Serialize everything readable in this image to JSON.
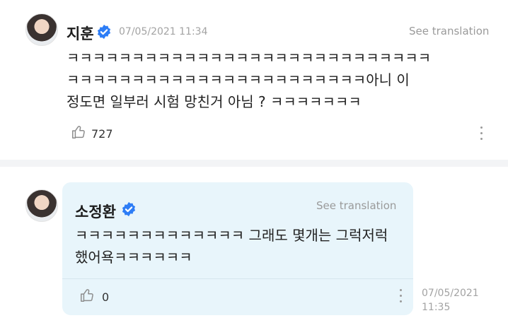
{
  "comment1": {
    "author": "지훈",
    "timestamp": "07/05/2021 11:34",
    "see_translation": "See translation",
    "text_lines": [
      "ㅋㅋㅋㅋㅋㅋㅋㅋㅋㅋㅋㅋㅋㅋㅋㅋㅋㅋㅋㅋㅋㅋㅋㅋㅋㅋㅋㅋ",
      "ㅋㅋㅋㅋㅋㅋㅋㅋㅋㅋㅋㅋㅋㅋㅋㅋㅋㅋㅋㅋㅋㅋㅋ아니 이",
      "정도면 일부러 시험 망친거 아님 ? ㅋㅋㅋㅋㅋㅋㅋ"
    ],
    "likes": "727",
    "icons": {
      "like": "thumbs-up-icon",
      "more": "more-vertical-icon",
      "verified": "verified-badge-icon"
    }
  },
  "reply": {
    "author": "소정환",
    "see_translation": "See translation",
    "text_lines": [
      "ㅋㅋㅋㅋㅋㅋㅋㅋㅋㅋㅋㅋㅋ 그래도 몇개는 그럭저럭",
      "했어욕ㅋㅋㅋㅋㅋㅋ"
    ],
    "likes": "0",
    "date_line1": "07/05/2021",
    "date_line2": "11:35"
  },
  "colors": {
    "verified_blue": "#2d7df6",
    "reply_background": "#e8f5fb",
    "muted_text": "#a3a3a3"
  }
}
